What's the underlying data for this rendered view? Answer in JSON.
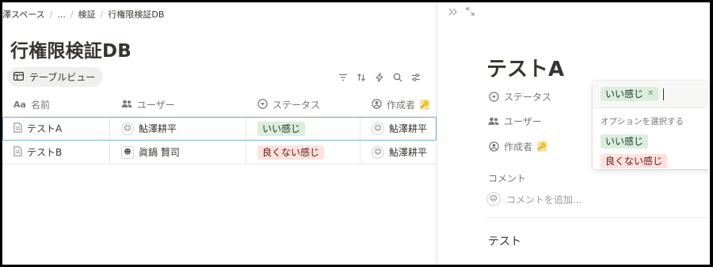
{
  "breadcrumb": [
    "澤スペース",
    "...",
    "検証",
    "行権限検証DB"
  ],
  "page_title": "行権限検証DB",
  "view_tab": {
    "label": "テーブルビュー"
  },
  "toolbar": {
    "icons": [
      "filter-icon",
      "sort-icon",
      "automation-icon",
      "search-icon",
      "settings-icon"
    ]
  },
  "table": {
    "headers": {
      "name": "名前",
      "name_icon": "Aa",
      "user": "ユーザー",
      "status": "ステータス",
      "creator": "作成者"
    },
    "rows": [
      {
        "name": "テストA",
        "user": "鮎澤耕平",
        "status": "いい感じ",
        "status_color": "#dbeddb",
        "creator": "鮎澤耕平"
      },
      {
        "name": "テストB",
        "user": "眞鍋 賢司",
        "status": "良くない感じ",
        "status_color": "#ffe2dd",
        "creator": "鮎澤耕平"
      }
    ]
  },
  "peek": {
    "title": "テストA",
    "props": {
      "status": "ステータス",
      "user": "ユーザー",
      "creator": "作成者"
    },
    "comments_label": "コメント",
    "comment_placeholder": "コメントを追加...",
    "body_text": "テスト"
  },
  "dropdown": {
    "selected": "いい感じ",
    "hint": "オプションを選択する",
    "options": [
      {
        "label": "いい感じ",
        "color": "#dbeddb"
      },
      {
        "label": "良くない感じ",
        "color": "#ffe2dd"
      }
    ]
  }
}
